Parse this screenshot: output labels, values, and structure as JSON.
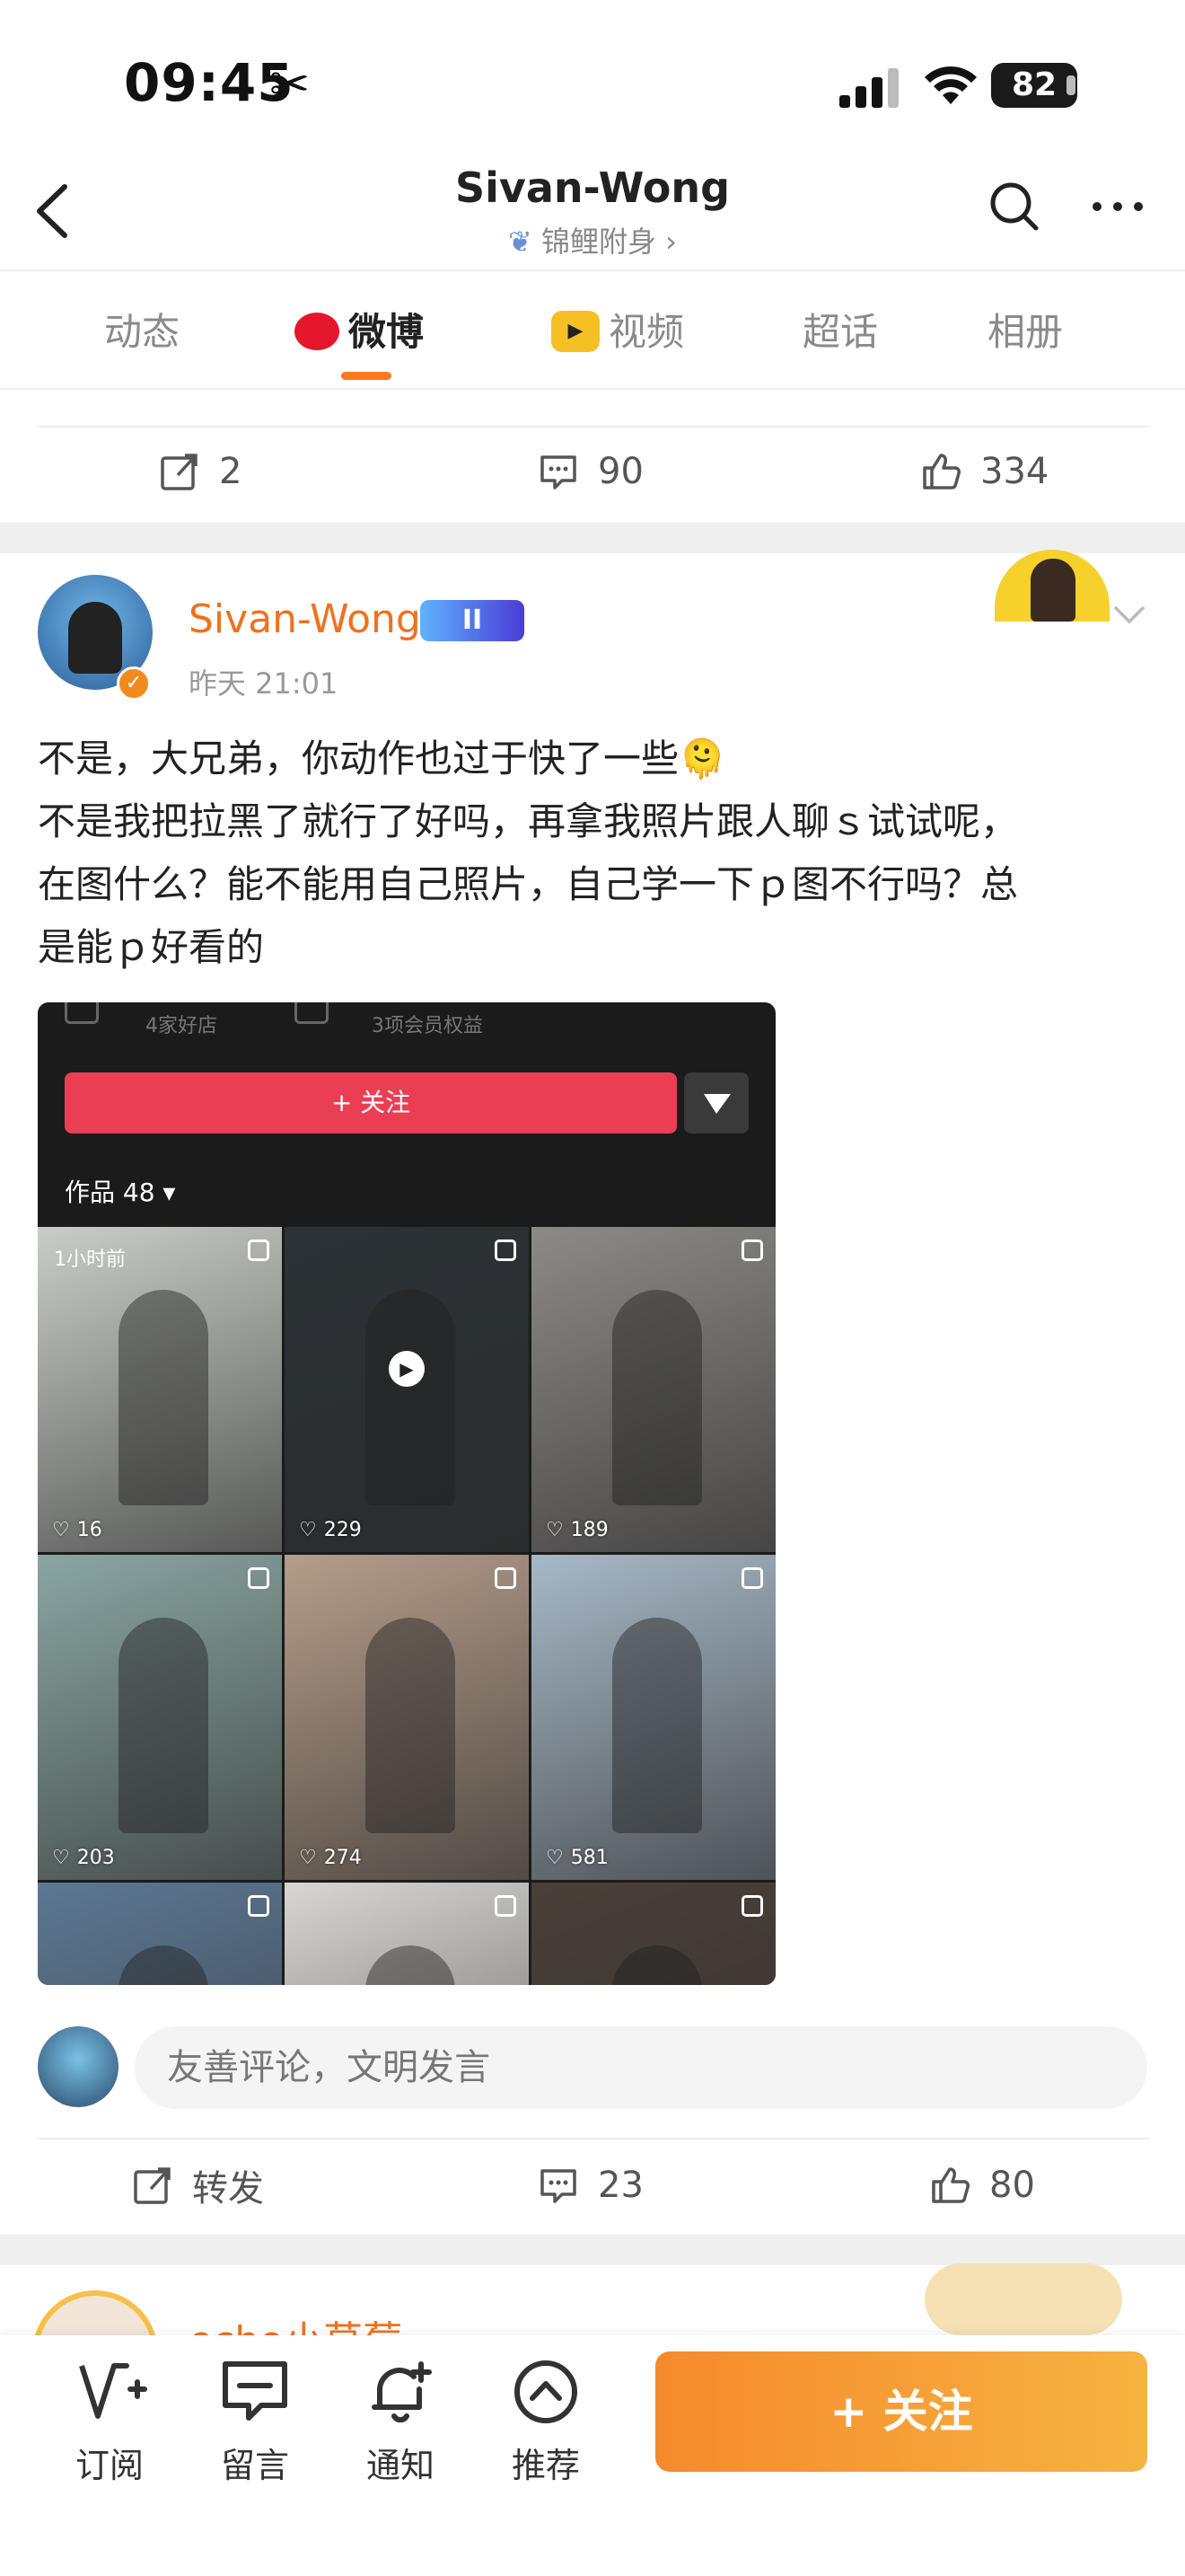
{
  "status_bar": {
    "time": "09:45",
    "battery": "82"
  },
  "nav": {
    "title": "Sivan-Wong",
    "subtitle": "锦鲤附身 ›"
  },
  "tabs": [
    {
      "label": "动态"
    },
    {
      "label": "微博"
    },
    {
      "label": "视频"
    },
    {
      "label": "超话"
    },
    {
      "label": "相册"
    }
  ],
  "prev_post_actions": {
    "repost": "2",
    "comment": "90",
    "like": "334"
  },
  "post": {
    "username": "Sivan-Wong",
    "badge": "II",
    "time": "昨天 21:01",
    "text_lines": [
      "不是，大兄弟，你动作也过于快了一些🫠",
      "不是我把拉黑了就行了好吗，再拿我照片跟人聊ｓ试试呢，",
      "在图什么？能不能用自己照片，自己学一下ｐ图不行吗？总",
      "是能ｐ好看的"
    ],
    "screenshot": {
      "store_info": "4家好店",
      "member_info": "3项会员权益",
      "follow_label": "+ 关注",
      "works_label": "作品 48 ▾",
      "cells": [
        {
          "likes": "16",
          "label": "1小时前",
          "color": "#c9cdc7"
        },
        {
          "likes": "229",
          "label": "",
          "color": "#2c3236"
        },
        {
          "likes": "189",
          "label": "",
          "color": "#8c8a86"
        },
        {
          "likes": "203",
          "label": "",
          "color": "#8aa6a2"
        },
        {
          "likes": "274",
          "label": "",
          "color": "#b49d8a"
        },
        {
          "likes": "581",
          "label": "",
          "color": "#a7b8c6"
        },
        {
          "likes": "",
          "label": "",
          "color": "#5d7893"
        },
        {
          "likes": "",
          "label": "",
          "color": "#d8d6d2"
        },
        {
          "likes": "",
          "label": "",
          "color": "#4a4038"
        }
      ]
    },
    "comment_placeholder": "友善评论，文明发言",
    "actions": {
      "repost": "转发",
      "comment": "23",
      "like": "80"
    }
  },
  "next_post": {
    "username": "echo小草莓"
  },
  "bottom_bar": {
    "items": [
      {
        "label": "订阅"
      },
      {
        "label": "留言"
      },
      {
        "label": "通知"
      },
      {
        "label": "推荐"
      }
    ],
    "follow_label": "+ 关注"
  },
  "colors": {
    "accent_orange": "#f0711e",
    "follow_gradient_start": "#f58a2c",
    "follow_gradient_end": "#f7b341",
    "red_button": "#ea3e55"
  }
}
